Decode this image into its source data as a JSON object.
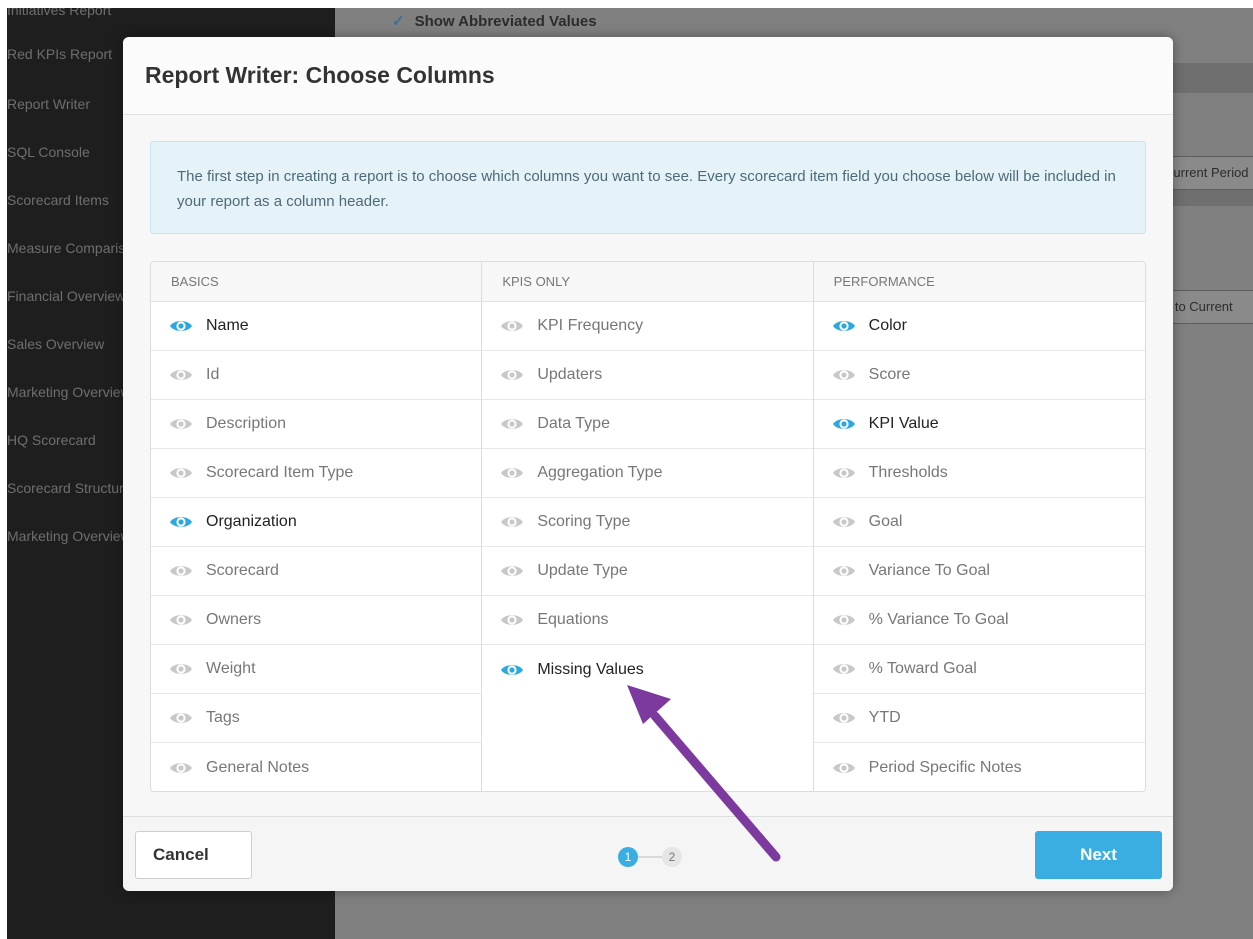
{
  "background": {
    "sidebar_items": [
      "Initiatives Report",
      "Red KPIs Report",
      "Report Writer",
      "SQL Console",
      "Scorecard Items",
      "Measure Comparison",
      "Financial Overview",
      "Sales Overview",
      "Marketing Overview",
      "HQ Scorecard",
      "Scorecard Structure",
      "Marketing Overview"
    ],
    "checkbox_label": "Show Abbreviated Values",
    "right_field_1": "Current Period",
    "right_field_2": "d to Current"
  },
  "modal": {
    "title": "Report Writer: Choose Columns",
    "info_text": "The first step in creating a report is to choose which columns you want to see. Every scorecard item field you choose below will be included in your report as a column header.",
    "columns": [
      {
        "header": "BASICS",
        "items": [
          {
            "label": "Name",
            "selected": true
          },
          {
            "label": "Id",
            "selected": false
          },
          {
            "label": "Description",
            "selected": false
          },
          {
            "label": "Scorecard Item Type",
            "selected": false
          },
          {
            "label": "Organization",
            "selected": true
          },
          {
            "label": "Scorecard",
            "selected": false
          },
          {
            "label": "Owners",
            "selected": false
          },
          {
            "label": "Weight",
            "selected": false
          },
          {
            "label": "Tags",
            "selected": false
          },
          {
            "label": "General Notes",
            "selected": false
          }
        ]
      },
      {
        "header": "KPIS ONLY",
        "items": [
          {
            "label": "KPI Frequency",
            "selected": false
          },
          {
            "label": "Updaters",
            "selected": false
          },
          {
            "label": "Data Type",
            "selected": false
          },
          {
            "label": "Aggregation Type",
            "selected": false
          },
          {
            "label": "Scoring Type",
            "selected": false
          },
          {
            "label": "Update Type",
            "selected": false
          },
          {
            "label": "Equations",
            "selected": false
          },
          {
            "label": "Missing Values",
            "selected": true
          }
        ]
      },
      {
        "header": "PERFORMANCE",
        "items": [
          {
            "label": "Color",
            "selected": true
          },
          {
            "label": "Score",
            "selected": false
          },
          {
            "label": "KPI Value",
            "selected": true
          },
          {
            "label": "Thresholds",
            "selected": false
          },
          {
            "label": "Goal",
            "selected": false
          },
          {
            "label": "Variance To Goal",
            "selected": false
          },
          {
            "label": "% Variance To Goal",
            "selected": false
          },
          {
            "label": "% Toward Goal",
            "selected": false
          },
          {
            "label": "YTD",
            "selected": false
          },
          {
            "label": "Period Specific Notes",
            "selected": false
          }
        ]
      }
    ],
    "footer": {
      "cancel_label": "Cancel",
      "next_label": "Next",
      "steps": [
        "1",
        "2"
      ],
      "active_step": 1
    }
  },
  "colors": {
    "accent": "#3aaee3",
    "eye_selected": "#2ba8e0",
    "eye_unselected": "#c8c8c8",
    "annotation_arrow": "#7d3a9e"
  }
}
